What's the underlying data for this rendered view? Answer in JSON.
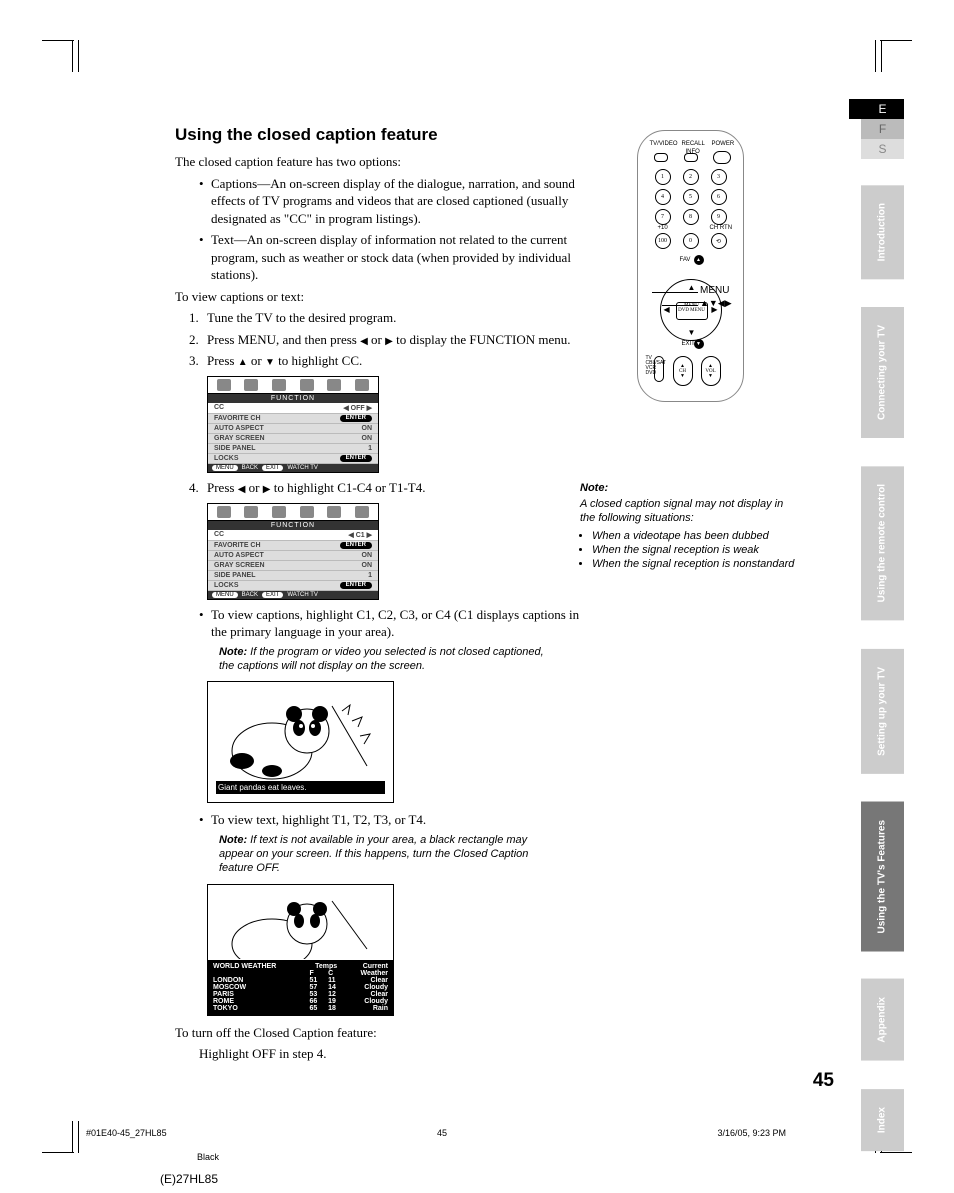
{
  "lang_tabs": {
    "e": "E",
    "f": "F",
    "s": "S"
  },
  "side_tabs": [
    "Introduction",
    "Connecting your TV",
    "Using the remote control",
    "Setting up your TV",
    "Using the TV's Features",
    "Appendix",
    "Index"
  ],
  "heading": "Using the closed caption feature",
  "intro": "The closed caption feature has two options:",
  "bullets": [
    "Captions—An on-screen display of the dialogue, narration, and sound effects of TV programs and videos that are closed captioned (usually designated as \"CC\" in program listings).",
    "Text—An on-screen display of information not related to the current program, such as weather or stock data (when provided by individual stations)."
  ],
  "to_view": "To view captions or text:",
  "steps": {
    "s1": "Tune the TV to the desired program.",
    "s2a": "Press MENU, and then press ",
    "s2b": " or ",
    "s2c": " to display the FUNCTION menu.",
    "s3a": "Press ",
    "s3b": " or ",
    "s3c": " to highlight CC.",
    "s4a": "Press ",
    "s4b": " or ",
    "s4c": " to highlight C1-C4 or T1-T4."
  },
  "menu1": {
    "title": "FUNCTION",
    "rows": [
      {
        "label": "CC",
        "val": "OFF",
        "sel": true
      },
      {
        "label": "FAVORITE CH",
        "val": "ENTER",
        "pill": true
      },
      {
        "label": "AUTO ASPECT",
        "val": "ON"
      },
      {
        "label": "GRAY SCREEN",
        "val": "ON"
      },
      {
        "label": "SIDE PANEL",
        "val": "1"
      },
      {
        "label": "LOCKS",
        "val": "ENTER",
        "pill": true
      }
    ],
    "foot": {
      "menu": "MENU",
      "back": "BACK",
      "exit": "EXIT",
      "watch": "WATCH TV"
    }
  },
  "menu2": {
    "title": "FUNCTION",
    "rows": [
      {
        "label": "CC",
        "val": "C1",
        "sel": true
      },
      {
        "label": "FAVORITE CH",
        "val": "ENTER",
        "pill": true
      },
      {
        "label": "AUTO ASPECT",
        "val": "ON"
      },
      {
        "label": "GRAY SCREEN",
        "val": "ON"
      },
      {
        "label": "SIDE PANEL",
        "val": "1"
      },
      {
        "label": "LOCKS",
        "val": "ENTER",
        "pill": true
      }
    ]
  },
  "view_captions": "To view captions, highlight C1, C2, C3, or C4 (C1 displays captions in the primary language in your area).",
  "note1_label": "Note:",
  "note1": " If the program or video you selected is not closed captioned, the captions will not display on the screen.",
  "caption_strip": "Giant  pandas  eat  leaves.",
  "view_text": "To view text, highlight T1, T2, T3, or T4.",
  "note2": " If text is not available in your area, a black rectangle may appear on your screen. If this happens, turn the Closed Caption feature OFF.",
  "weather": {
    "title": "WORLD WEATHER",
    "head": {
      "temps": "Temps",
      "f": "F",
      "c": "C",
      "cur": "Current",
      "wea": "Weather"
    },
    "rows": [
      {
        "city": "LONDON",
        "f": "51",
        "c": "11",
        "w": "Clear"
      },
      {
        "city": "MOSCOW",
        "f": "57",
        "c": "14",
        "w": "Cloudy"
      },
      {
        "city": "PARIS",
        "f": "53",
        "c": "12",
        "w": "Clear"
      },
      {
        "city": "ROME",
        "f": "66",
        "c": "19",
        "w": "Cloudy"
      },
      {
        "city": "TOKYO",
        "f": "65",
        "c": "18",
        "w": "Rain"
      }
    ]
  },
  "turn_off1": "To turn off the Closed Caption feature:",
  "turn_off2": "Highlight OFF in step 4.",
  "remote_labels": {
    "tvvideo": "TV/VIDEO",
    "recall": "RECALL",
    "info": "INFO",
    "power": "POWER",
    "plus10": "+10",
    "chrtn": "CH RTN",
    "fav": "FAV",
    "menu": "MENU",
    "dvdmenu": "DVD MENU",
    "exit": "EXIT",
    "ch": "CH",
    "vol": "VOL",
    "mode": "TV CBL/SAT VCR DVD"
  },
  "remote_menu": "MENU",
  "remote_arrows": "▲▼◀▶",
  "right_note": {
    "head": "Note:",
    "body": "A closed caption signal may not display in the following situations:",
    "items": [
      "When a videotape has been dubbed",
      "When the signal reception is weak",
      "When the signal reception is nonstandard"
    ]
  },
  "pagenum": "45",
  "foot_left": "#01E40-45_27HL85",
  "foot_mid": "45",
  "foot_right": "3/16/05, 9:23 PM",
  "foot_black": "Black",
  "foot_model": "(E)27HL85"
}
